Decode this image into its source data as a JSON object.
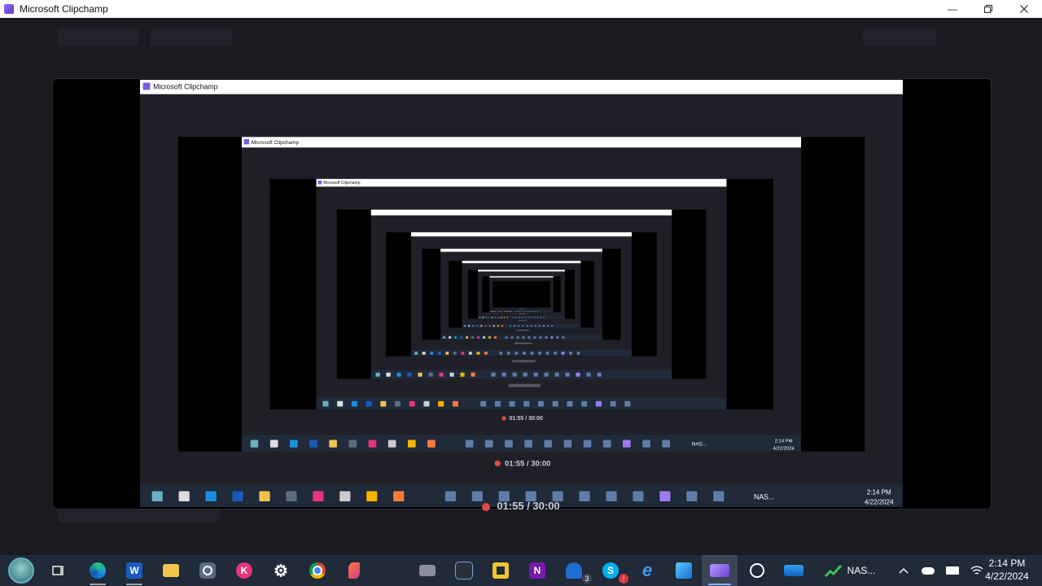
{
  "window": {
    "title": "Microsoft Clipchamp"
  },
  "recording": {
    "timer": "01:55 / 30:00"
  },
  "nested_windows": [
    {
      "title": "Microsoft Clipchamp",
      "timer": "01:55 / 30:00",
      "clock_time": "2:14 PM",
      "clock_date": "4/22/2024",
      "tray_label": "NAS..."
    },
    {
      "title": "Microsoft Clipchamp",
      "timer": "01:55 / 30:00",
      "clock_time": "2:14 PM",
      "clock_date": "4/22/2024",
      "tray_label": "NAS..."
    }
  ],
  "taskbar": {
    "apps": [
      {
        "name": "start-orb",
        "label": ""
      },
      {
        "name": "task-view",
        "label": ""
      },
      {
        "name": "edge",
        "label": ""
      },
      {
        "name": "word",
        "label": "W"
      },
      {
        "name": "file-explorer",
        "label": ""
      },
      {
        "name": "camera",
        "label": ""
      },
      {
        "name": "k-app",
        "label": "K"
      },
      {
        "name": "settings",
        "label": "⚙"
      },
      {
        "name": "chrome",
        "label": ""
      },
      {
        "name": "paint-tool",
        "label": ""
      },
      {
        "name": "photo-tool",
        "label": ""
      },
      {
        "name": "discord",
        "label": ""
      },
      {
        "name": "notepad-tool",
        "label": ""
      },
      {
        "name": "onenote",
        "label": "N"
      },
      {
        "name": "mail",
        "label": "3"
      },
      {
        "name": "skype",
        "label": "S"
      },
      {
        "name": "internet-explorer",
        "label": "e"
      },
      {
        "name": "photos",
        "label": ""
      },
      {
        "name": "clipchamp",
        "label": ""
      },
      {
        "name": "alexa",
        "label": ""
      },
      {
        "name": "mail-app",
        "label": ""
      }
    ],
    "tray": {
      "label": "NAS...",
      "time": "2:14 PM",
      "date": "4/22/2024"
    }
  }
}
